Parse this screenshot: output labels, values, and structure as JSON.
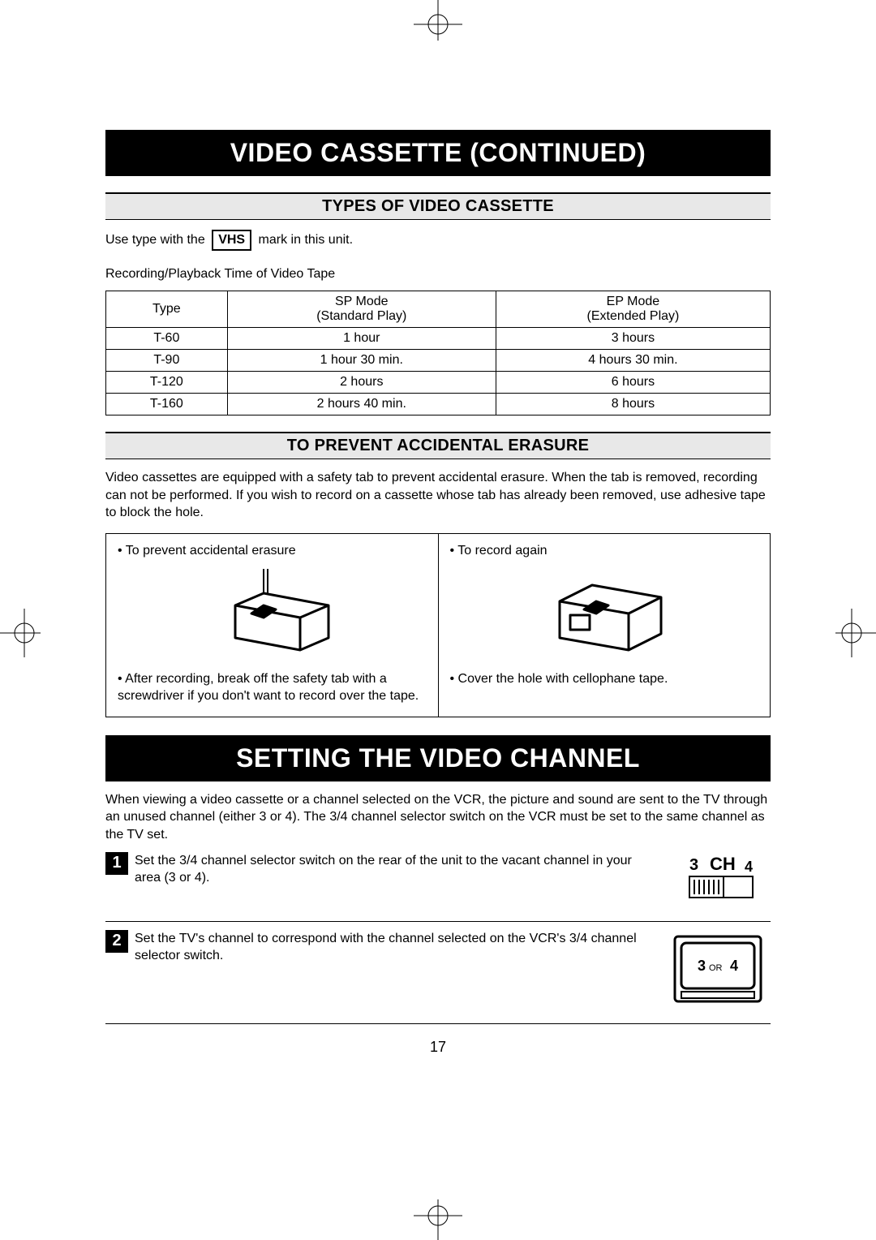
{
  "banner1": "VIDEO CASSETTE (CONTINUED)",
  "section1": "TYPES OF VIDEO CASSETTE",
  "useType1": "Use type with the",
  "vhsMark": "VHS",
  "useType2": "mark in this unit.",
  "tableCaption": "Recording/Playback Time of Video Tape",
  "tableHeader": {
    "c0": "Type",
    "c1a": "SP Mode",
    "c1b": "(Standard Play)",
    "c2a": "EP Mode",
    "c2b": "(Extended Play)"
  },
  "rows": [
    {
      "type": "T-60",
      "sp": "1 hour",
      "ep": "3 hours"
    },
    {
      "type": "T-90",
      "sp": "1 hour 30 min.",
      "ep": "4 hours 30 min."
    },
    {
      "type": "T-120",
      "sp": "2 hours",
      "ep": "6 hours"
    },
    {
      "type": "T-160",
      "sp": "2 hours 40 min.",
      "ep": "8 hours"
    }
  ],
  "section2": "TO PREVENT ACCIDENTAL ERASURE",
  "erasurePara": "Video cassettes are equipped with a safety tab to prevent accidental erasure. When the tab is removed, recording can not be performed. If you wish to record on a cassette whose tab has already been removed, use adhesive tape to block the hole.",
  "leftBullet1": "• To prevent accidental erasure",
  "leftBullet2": "• After recording, break off the safety tab with a screwdriver if you don't want to record over the tape.",
  "rightBullet1": "• To record again",
  "rightBullet2": "• Cover the hole with cellophane tape.",
  "banner2": "SETTING THE VIDEO CHANNEL",
  "channelPara": "When viewing a video cassette or a channel selected on the VCR, the picture and sound are sent to the TV through an unused channel (either 3 or 4). The 3/4 channel selector switch on the VCR must be set to the same channel as the TV set.",
  "step1num": "1",
  "step1text": "Set the 3/4 channel selector switch on the rear of the unit to the vacant channel in your area (3 or 4).",
  "switchLabel": {
    "left": "3",
    "mid": "CH",
    "right": "4"
  },
  "step2num": "2",
  "step2text": "Set the TV's channel to correspond with the channel selected on the VCR's 3/4 channel selector switch.",
  "tvText": {
    "a": "3",
    "or": "OR",
    "b": "4"
  },
  "pageNumber": "17"
}
